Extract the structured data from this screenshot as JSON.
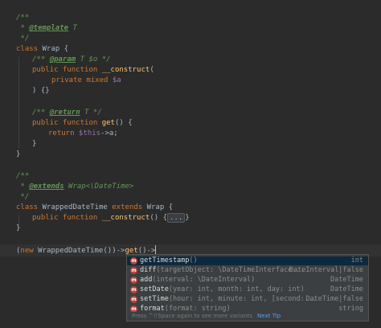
{
  "code": {
    "l1": "/**",
    "l2_pre": " * ",
    "l2_tag": "@template",
    "l2_post": " T",
    "l3": " */",
    "l4_kw": "class",
    "l4_rest": " Wrap {",
    "l5_pre": "/** ",
    "l5_tag": "@param",
    "l5_post": " T $o */",
    "l6_kw": "public function",
    "l6_fn": " __construct",
    "l6_rest": "(",
    "l7_kw": "private mixed",
    "l7_var": " $a",
    "l8": ") {}",
    "l9_pre": "/** ",
    "l9_tag": "@return",
    "l9_post": " T */",
    "l10_kw": "public function",
    "l10_fn": " get",
    "l10_rest": "() {",
    "l11_kw": "return",
    "l11_var": " $this",
    "l11_rest": "->a;",
    "l12": "}",
    "l13": "}",
    "l14": "/**",
    "l15_pre": " * ",
    "l15_tag": "@extends",
    "l15_post": " Wrap<\\DateTime>",
    "l16": " */",
    "l17_kw": "class",
    "l17_mid": " WrappedDateTime ",
    "l17_kw2": "extends",
    "l17_rest": " Wrap {",
    "l18_kw": "public function",
    "l18_fn": " __construct",
    "l18_rest": "() {",
    "l18_fold": "...",
    "l18_end": "}",
    "l19": "}",
    "l20_pre": "(",
    "l20_kw": "new",
    "l20_rest": " WrappedDateTime())->",
    "l20_fn": "get",
    "l20_end": "()->"
  },
  "completion": {
    "items": [
      {
        "name": "getTimestamp",
        "params": "()",
        "type": "int",
        "icon": "method-icon"
      },
      {
        "name": "diff",
        "params": "(targetObject: \\DateTimeInterface...",
        "type": "DateInterval|false",
        "icon": "method-icon"
      },
      {
        "name": "add",
        "params": "(interval: \\DateInterval)",
        "type": "DateTime",
        "icon": "method-icon"
      },
      {
        "name": "setDate",
        "params": "(year: int, month: int, day: int)",
        "type": "DateTime",
        "icon": "method-icon"
      },
      {
        "name": "setTime",
        "params": "(hour: int, minute: int, [second:...",
        "type": "DateTime|false",
        "icon": "method-icon"
      },
      {
        "name": "format",
        "params": "(format: string)",
        "type": "string",
        "icon": "method-icon"
      }
    ],
    "icon_letter": "m",
    "footer_hint": "Press ^⇧Space again to see more variants",
    "footer_link": "Next Tip"
  },
  "colors": {
    "background": "#2b2b2b",
    "keyword": "#cc7832",
    "function": "#ffc66d",
    "variable": "#9876aa",
    "doc": "#629755",
    "selection": "#0d293e"
  }
}
